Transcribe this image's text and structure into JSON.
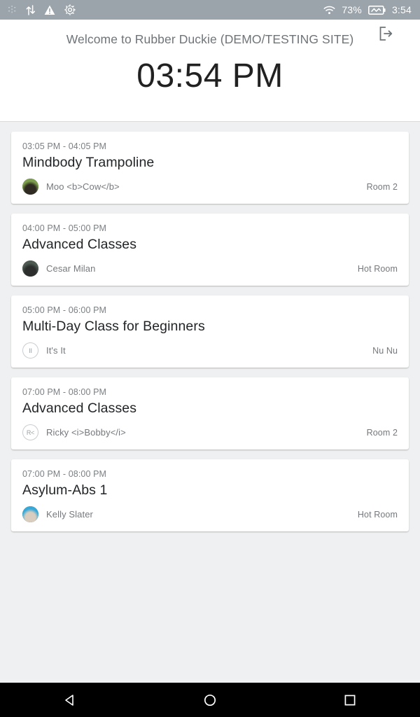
{
  "status_bar": {
    "left_icons": [
      "debug-dots-icon",
      "data-transfer-icon",
      "warning-triangle-icon",
      "settings-gear-icon"
    ],
    "wifi_icon": "wifi-icon",
    "battery_percent": "73%",
    "battery_icon": "battery-charging-icon",
    "clock": "3:54",
    "background": "#9ba4ab"
  },
  "header": {
    "welcome_text": "Welcome to Rubber Duckie (DEMO/TESTING SITE)",
    "logout_icon": "logout-icon",
    "clock": "03:54 PM",
    "background": "#ffffff"
  },
  "classes": [
    {
      "time": "03:05 PM - 04:05 PM",
      "title": "Mindbody Trampoline",
      "instructor": "Moo <b>Cow</b>",
      "avatar_type": "photo",
      "avatar_colors": [
        "#7d9e4e",
        "#2f2a22"
      ],
      "room": "Room 2"
    },
    {
      "time": "04:00 PM - 05:00 PM",
      "title": "Advanced Classes",
      "instructor": "Cesar Milan",
      "avatar_type": "photo",
      "avatar_colors": [
        "#4d5a52",
        "#2b2e2c"
      ],
      "room": "Hot Room"
    },
    {
      "time": "05:00 PM - 06:00 PM",
      "title": "Multi-Day Class for Beginners",
      "instructor": "It's  It",
      "avatar_type": "initials",
      "avatar_initials": "II",
      "room": "Nu Nu"
    },
    {
      "time": "07:00 PM - 08:00 PM",
      "title": "Advanced Classes",
      "instructor": "Ricky <i>Bobby</i>",
      "avatar_type": "initials",
      "avatar_initials": "R<",
      "room": "Room 2"
    },
    {
      "time": "07:00 PM - 08:00 PM",
      "title": "Asylum-Abs 1",
      "instructor": "Kelly Slater",
      "avatar_type": "photo",
      "avatar_colors": [
        "#37a8d8",
        "#d8cdbe"
      ],
      "room": "Hot Room"
    }
  ],
  "nav_bar": {
    "back_icon": "back-triangle-icon",
    "home_icon": "home-circle-icon",
    "recents_icon": "recents-square-icon",
    "background": "#000000"
  },
  "theme": {
    "content_background": "#eff0f1",
    "card_background": "#ffffff",
    "title_color": "#222527",
    "muted_color": "#75797d"
  }
}
